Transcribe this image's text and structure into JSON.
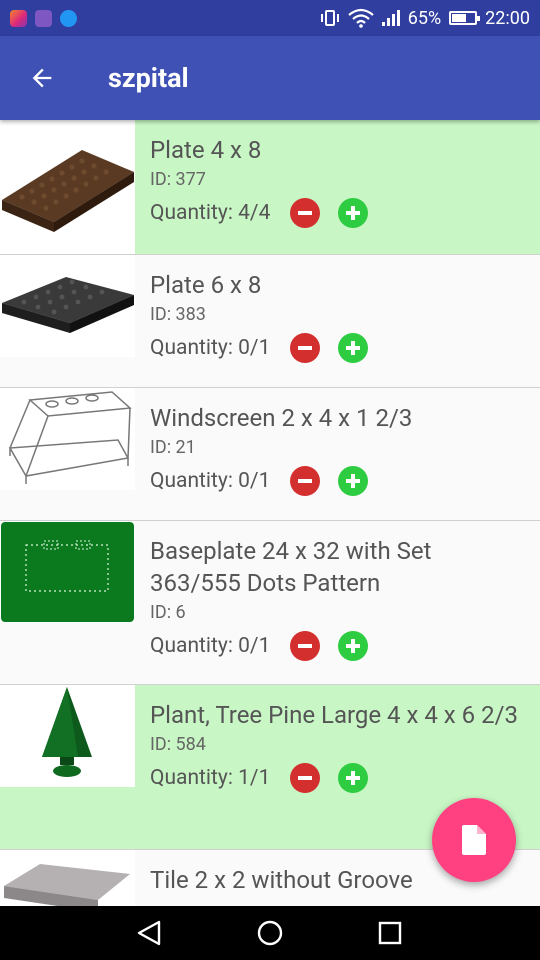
{
  "status_bar": {
    "battery_percent": "65%",
    "battery_level": 0.65,
    "time": "22:00",
    "notification_icons": [
      "instagram-icon",
      "gallery-icon",
      "messenger-icon"
    ]
  },
  "app_bar": {
    "title": "szpital"
  },
  "items": [
    {
      "name": "Plate 4 x 8",
      "id": "ID: 377",
      "quantity": "Quantity: 4/4",
      "complete": true
    },
    {
      "name": "Plate 6 x 8",
      "id": "ID: 383",
      "quantity": "Quantity: 0/1",
      "complete": false
    },
    {
      "name": "Windscreen 2 x 4 x 1 2/3",
      "id": "ID: 21",
      "quantity": "Quantity: 0/1",
      "complete": false
    },
    {
      "name": "Baseplate 24 x 32 with Set 363/555 Dots Pattern",
      "id": "ID: 6",
      "quantity": "Quantity: 0/1",
      "complete": false
    },
    {
      "name": "Plant, Tree Pine Large 4 x 4 x 6 2/3",
      "id": "ID: 584",
      "quantity": "Quantity: 1/1",
      "complete": true
    },
    {
      "name": "Tile 2 x 2 without Groove",
      "id": "",
      "quantity": "",
      "complete": false
    }
  ],
  "colors": {
    "status_bar": "#303F9F",
    "app_bar": "#3F51B5",
    "complete_row": "#C8F7C5",
    "minus_button": "#D32F2F",
    "plus_button": "#2ECC40",
    "fab": "#FF4081"
  },
  "fab_icon": "file-icon"
}
